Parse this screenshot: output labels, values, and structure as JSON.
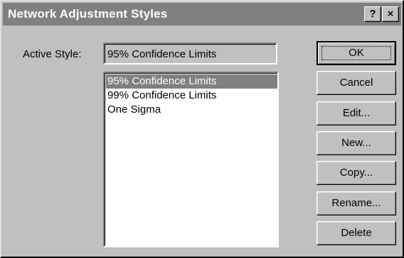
{
  "window": {
    "title": "Network Adjustment Styles",
    "help_glyph": "?",
    "close_glyph": "×"
  },
  "active_style": {
    "label": "Active Style:",
    "value": "95% Confidence Limits"
  },
  "styles_list": {
    "items": [
      {
        "label": "95% Confidence Limits",
        "selected": true
      },
      {
        "label": "99% Confidence Limits",
        "selected": false
      },
      {
        "label": "One Sigma",
        "selected": false
      }
    ]
  },
  "buttons": {
    "ok": "OK",
    "cancel": "Cancel",
    "edit": "Edit...",
    "new": "New...",
    "copy": "Copy...",
    "rename": "Rename...",
    "delete": "Delete"
  },
  "colors": {
    "face": "#c0c0c0",
    "title_bar": "#808080",
    "selection": "#808080"
  }
}
